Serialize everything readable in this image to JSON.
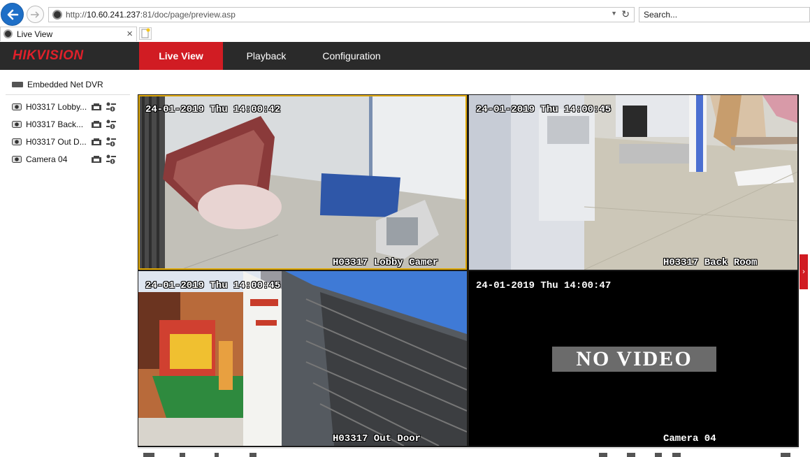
{
  "browser": {
    "url_prefix": "http://",
    "url_domain": "10.60.241.237",
    "url_rest": ":81/doc/page/preview.asp",
    "search_placeholder": "Search...",
    "tab_title": "Live View"
  },
  "header": {
    "logo": "HIKVISION",
    "nav": [
      {
        "label": "Live View",
        "active": true
      },
      {
        "label": "Playback",
        "active": false
      },
      {
        "label": "Configuration",
        "active": false
      }
    ],
    "accent_color": "#d11c23"
  },
  "sidebar": {
    "device": "Embedded Net DVR",
    "cameras": [
      {
        "label": "H03317 Lobby..."
      },
      {
        "label": "H03317 Back..."
      },
      {
        "label": "H03317 Out D..."
      },
      {
        "label": "Camera 04"
      }
    ]
  },
  "tiles": [
    {
      "time": "24-01-2019 Thu 14:00:42",
      "name": "H03317 Lobby Camer"
    },
    {
      "time": "24-01-2019 Thu 14:00:45",
      "name": "H03317 Back Room"
    },
    {
      "time": "24-01-2019 Thu 14:00:45",
      "name": "H03317 Out Door"
    },
    {
      "time": "24-01-2019 Thu 14:00:47",
      "name": "Camera 04",
      "overlay": "NO VIDEO"
    }
  ]
}
